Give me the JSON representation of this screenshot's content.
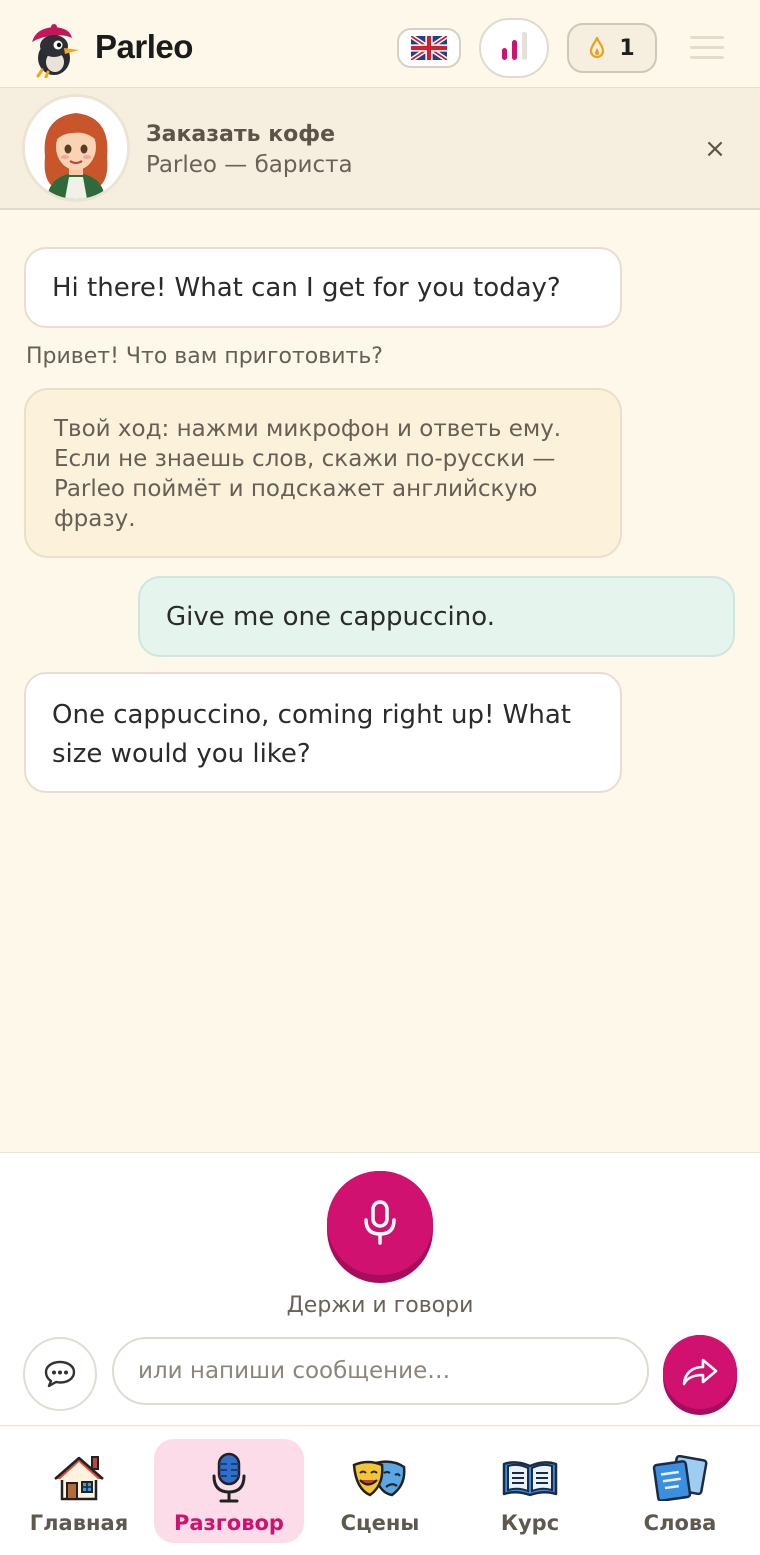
{
  "header": {
    "brand": "Parleo",
    "streak_count": "1"
  },
  "scene": {
    "title": "Заказать кофе",
    "subtitle": "Parleo — бариста",
    "close_label": "×"
  },
  "messages": {
    "bot_1": "Hi there! What can I get for you today?",
    "bot_1_translation": "Привет! Что вам приготовить?",
    "hint": "Твой ход: нажми микрофон и ответь ему. Если не знаешь слов, скажи по-русски — Parleo поймёт и подскажет английскую фразу.",
    "user_1": "Give me one cappuccino.",
    "bot_2": "One cappuccino, coming right up! What size would you like?"
  },
  "input": {
    "mic_label": "Держи и говори",
    "placeholder": "или напиши сообщение…"
  },
  "nav": {
    "items": [
      {
        "label": "Главная",
        "icon": "home-icon"
      },
      {
        "label": "Разговор",
        "icon": "microphone-icon",
        "active": true
      },
      {
        "label": "Сцены",
        "icon": "theater-masks-icon"
      },
      {
        "label": "Курс",
        "icon": "open-book-icon"
      },
      {
        "label": "Слова",
        "icon": "word-cards-icon"
      }
    ]
  },
  "colors": {
    "accent": "#d1116f",
    "background": "#fdf8ea",
    "user_bubble": "#e6f4ee"
  }
}
